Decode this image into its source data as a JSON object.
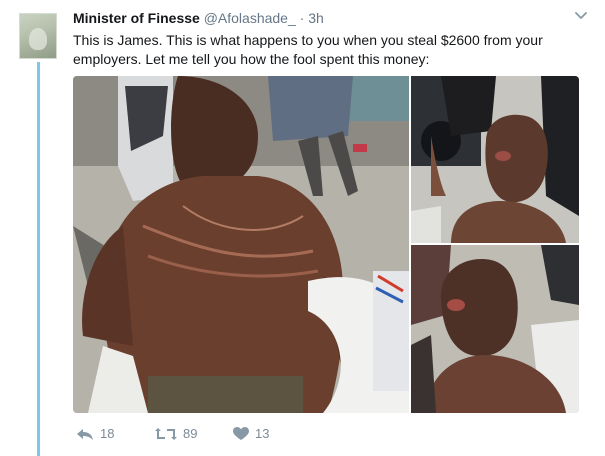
{
  "tweet": {
    "display_name": "Minister of Finesse",
    "handle": "@Afolashade_",
    "separator": "·",
    "time": "3h",
    "text": "This is James. This is what happens to you when you steal $2600 from your employers. Let me tell you how the fool spent this money:"
  },
  "actions": {
    "reply_count": "18",
    "retweet_count": "89",
    "like_count": "13"
  },
  "icons": [
    "chevron-down-icon",
    "reply-icon",
    "retweet-icon",
    "heart-icon"
  ],
  "colors": {
    "thread_line": "#7fc7e7",
    "muted": "#657786",
    "action_icon": "#8899a6"
  }
}
